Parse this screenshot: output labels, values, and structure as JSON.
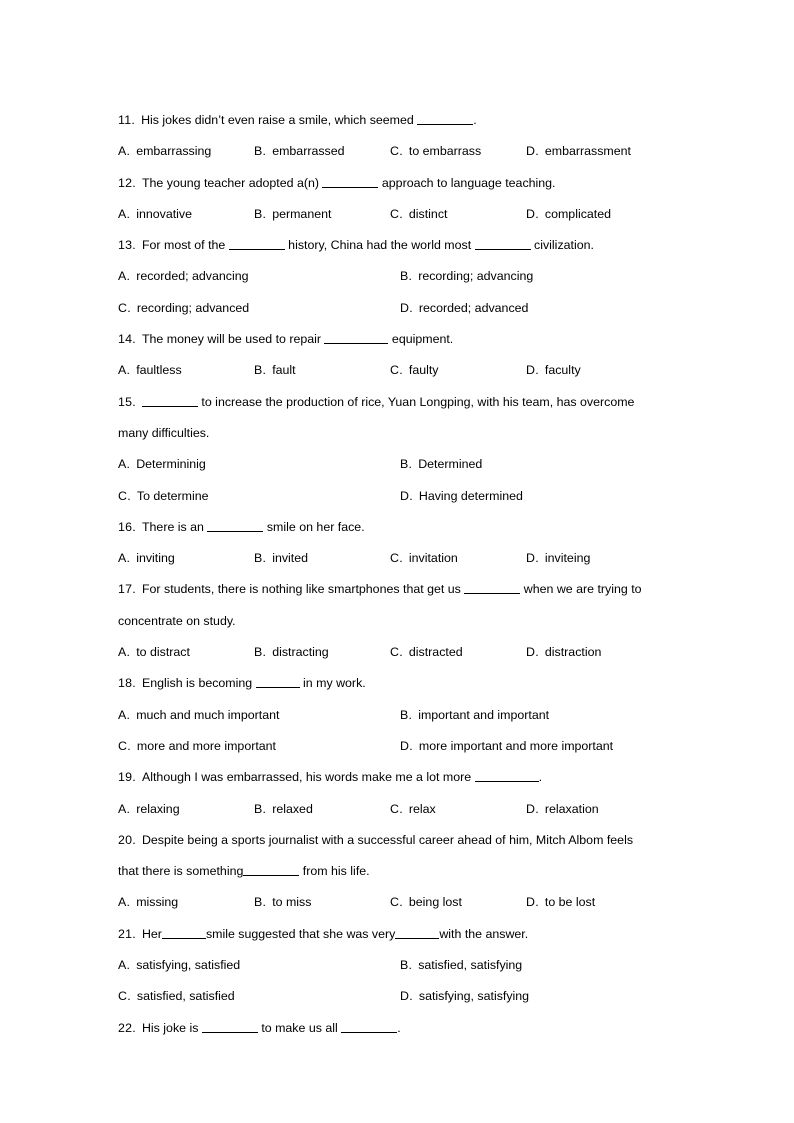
{
  "document": {
    "type": "grammar-multiple-choice-worksheet",
    "page_background": "#ffffff",
    "text_color": "#000000",
    "questions": [
      {
        "number": "11.",
        "stem_parts": [
          "His jokes didn’t even raise a smile, which seemed ",
          "BLANK_MD",
          "."
        ],
        "stem_text": "His jokes didn’t even raise a smile, which seemed ________.",
        "layout": "cols4",
        "options": [
          {
            "letter": "A.",
            "text": "embarrassing"
          },
          {
            "letter": "B.",
            "text": "embarrassed"
          },
          {
            "letter": "C.",
            "text": "to embarrass"
          },
          {
            "letter": "D.",
            "text": "embarrassment"
          }
        ]
      },
      {
        "number": "12.",
        "stem_parts": [
          "The young teacher adopted a(n) ",
          "BLANK_MD",
          " approach to language teaching."
        ],
        "stem_text": "The young teacher adopted a(n) ________ approach to language teaching.",
        "layout": "cols4",
        "options": [
          {
            "letter": "A.",
            "text": "innovative"
          },
          {
            "letter": "B.",
            "text": "permanent"
          },
          {
            "letter": "C.",
            "text": "distinct"
          },
          {
            "letter": "D.",
            "text": "complicated"
          }
        ]
      },
      {
        "number": "13.",
        "stem_parts": [
          "For most of the ",
          "BLANK_MD",
          " history, China had the world most ",
          "BLANK_MD",
          " civilization."
        ],
        "stem_text": "For most of the ________ history, China had the world most ________ civilization.",
        "layout": "cols2",
        "options": [
          {
            "letter": "A.",
            "text": "recorded; advancing"
          },
          {
            "letter": "B.",
            "text": "recording; advancing"
          },
          {
            "letter": "C.",
            "text": "recording; advanced"
          },
          {
            "letter": "D.",
            "text": "recorded; advanced"
          }
        ]
      },
      {
        "number": "14.",
        "stem_parts": [
          "The money will be used to repair ",
          "BLANK_LG",
          " equipment."
        ],
        "stem_text": "The money will be used to repair _________ equipment.",
        "layout": "cols4",
        "options": [
          {
            "letter": "A.",
            "text": "faultless"
          },
          {
            "letter": "B.",
            "text": "fault"
          },
          {
            "letter": "C.",
            "text": "faulty"
          },
          {
            "letter": "D.",
            "text": "faculty"
          }
        ]
      },
      {
        "number": "15.",
        "stem_parts": [
          "",
          "BLANK_MD",
          " to increase the production of rice, Yuan Longping, with his team, has overcome"
        ],
        "stem_text": "________ to increase the production of rice, Yuan Longping, with his team, has overcome",
        "continuation": "many difficulties.",
        "layout": "cols2",
        "options": [
          {
            "letter": "A.",
            "text": "Determininig"
          },
          {
            "letter": "B.",
            "text": "Determined"
          },
          {
            "letter": "C.",
            "text": "To determine"
          },
          {
            "letter": "D.",
            "text": "Having determined"
          }
        ]
      },
      {
        "number": "16.",
        "stem_parts": [
          "There is an ",
          "BLANK_MD",
          " smile on her face."
        ],
        "stem_text": "There is an ________ smile on her face.",
        "layout": "cols4",
        "options": [
          {
            "letter": "A.",
            "text": "inviting"
          },
          {
            "letter": "B.",
            "text": "invited"
          },
          {
            "letter": "C.",
            "text": "invitation"
          },
          {
            "letter": "D.",
            "text": "inviteing"
          }
        ]
      },
      {
        "number": "17.",
        "stem_parts": [
          "For students, there is nothing like smartphones that get us ",
          "BLANK_MD",
          " when we are trying to"
        ],
        "stem_text": "For students, there is nothing like smartphones that get us ________ when we are trying to",
        "continuation": "concentrate on study.",
        "layout": "cols4",
        "options": [
          {
            "letter": "A.",
            "text": "to distract"
          },
          {
            "letter": "B.",
            "text": "distracting"
          },
          {
            "letter": "C.",
            "text": "distracted"
          },
          {
            "letter": "D.",
            "text": "distraction"
          }
        ]
      },
      {
        "number": "18.",
        "stem_parts": [
          "English is becoming ",
          "BLANK_SM",
          " in my work."
        ],
        "stem_text": "English is becoming ______ in my work.",
        "layout": "cols2",
        "options": [
          {
            "letter": "A.",
            "text": "much and much important"
          },
          {
            "letter": "B.",
            "text": "important and important"
          },
          {
            "letter": "C.",
            "text": "more and more important"
          },
          {
            "letter": "D.",
            "text": "more important and more important"
          }
        ]
      },
      {
        "number": "19.",
        "stem_parts": [
          "Although I was embarrassed, his words make me a lot more ",
          "BLANK_LG",
          "."
        ],
        "stem_text": "Although I was embarrassed, his words make me a lot more _________.",
        "layout": "cols4",
        "options": [
          {
            "letter": "A.",
            "text": "relaxing"
          },
          {
            "letter": "B.",
            "text": "relaxed"
          },
          {
            "letter": "C.",
            "text": "relax"
          },
          {
            "letter": "D.",
            "text": "relaxation"
          }
        ]
      },
      {
        "number": "20.",
        "stem_parts": [
          "Despite being a sports journalist with a successful career ahead of him, Mitch Albom feels"
        ],
        "stem_text": "Despite being a sports journalist with a successful career ahead of him, Mitch Albom feels",
        "continuation_parts": [
          "that there is something",
          "BLANK_MD",
          " from his life."
        ],
        "continuation": "that there is something________ from his life.",
        "layout": "cols4",
        "options": [
          {
            "letter": "A.",
            "text": "missing"
          },
          {
            "letter": "B.",
            "text": "to miss"
          },
          {
            "letter": "C.",
            "text": "being lost"
          },
          {
            "letter": "D.",
            "text": "to be lost"
          }
        ]
      },
      {
        "number": "21.",
        "stem_parts": [
          "Her",
          "BLANK_SM",
          "smile suggested that she was very",
          "BLANK_SM",
          "with the answer."
        ],
        "stem_text": "Her______smile suggested that she was very______with the answer.",
        "layout": "cols2",
        "options": [
          {
            "letter": "A.",
            "text": "satisfying, satisfied"
          },
          {
            "letter": "B.",
            "text": "satisfied, satisfying"
          },
          {
            "letter": "C.",
            "text": "satisfied, satisfied"
          },
          {
            "letter": "D.",
            "text": "satisfying, satisfying"
          }
        ]
      },
      {
        "number": "22.",
        "stem_parts": [
          "His joke is ",
          "BLANK_MD",
          " to make us all ",
          "BLANK_MD",
          "."
        ],
        "stem_text": "His joke is ________ to make us all ________.",
        "layout": "none",
        "options": []
      }
    ]
  }
}
